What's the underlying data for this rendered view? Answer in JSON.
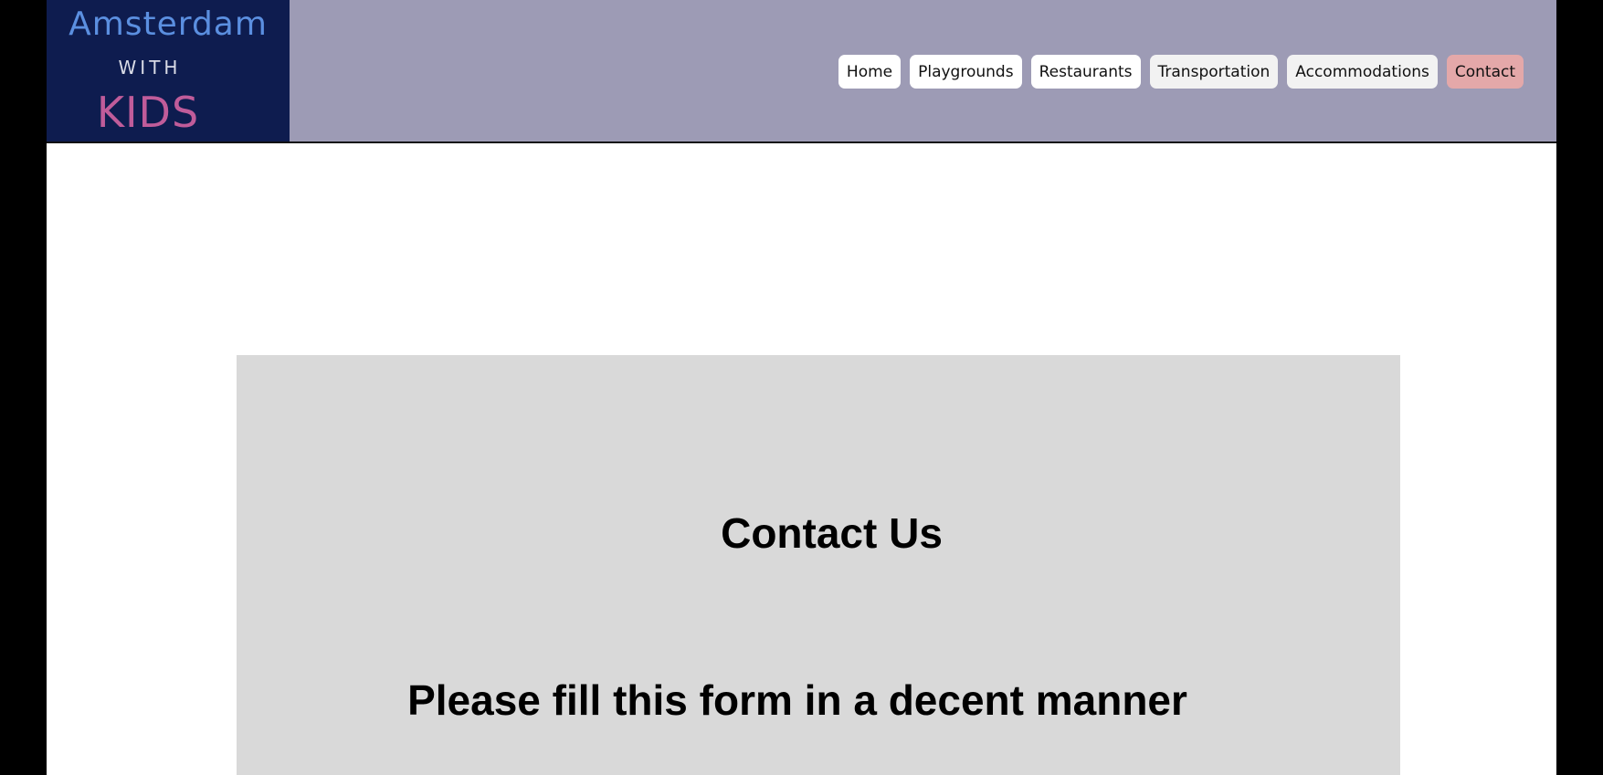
{
  "logo": {
    "line1": "Amsterdam",
    "line2": "WITH",
    "line3": "KIDS"
  },
  "nav": {
    "items": [
      {
        "label": "Home"
      },
      {
        "label": "Playgrounds"
      },
      {
        "label": "Restaurants"
      },
      {
        "label": "Transportation"
      },
      {
        "label": "Accommodations"
      },
      {
        "label": "Contact",
        "active": true
      }
    ]
  },
  "main": {
    "title": "Contact Us",
    "subtitle": "Please fill this form in a decent manner"
  },
  "colors": {
    "header_bg": "#9d9bb5",
    "logo_bg": "#0e1c4f",
    "logo_blue": "#5b8fe0",
    "logo_pink": "#c05c9a",
    "active_nav": "#e4a8a9",
    "form_bg": "#d9d9d9"
  }
}
